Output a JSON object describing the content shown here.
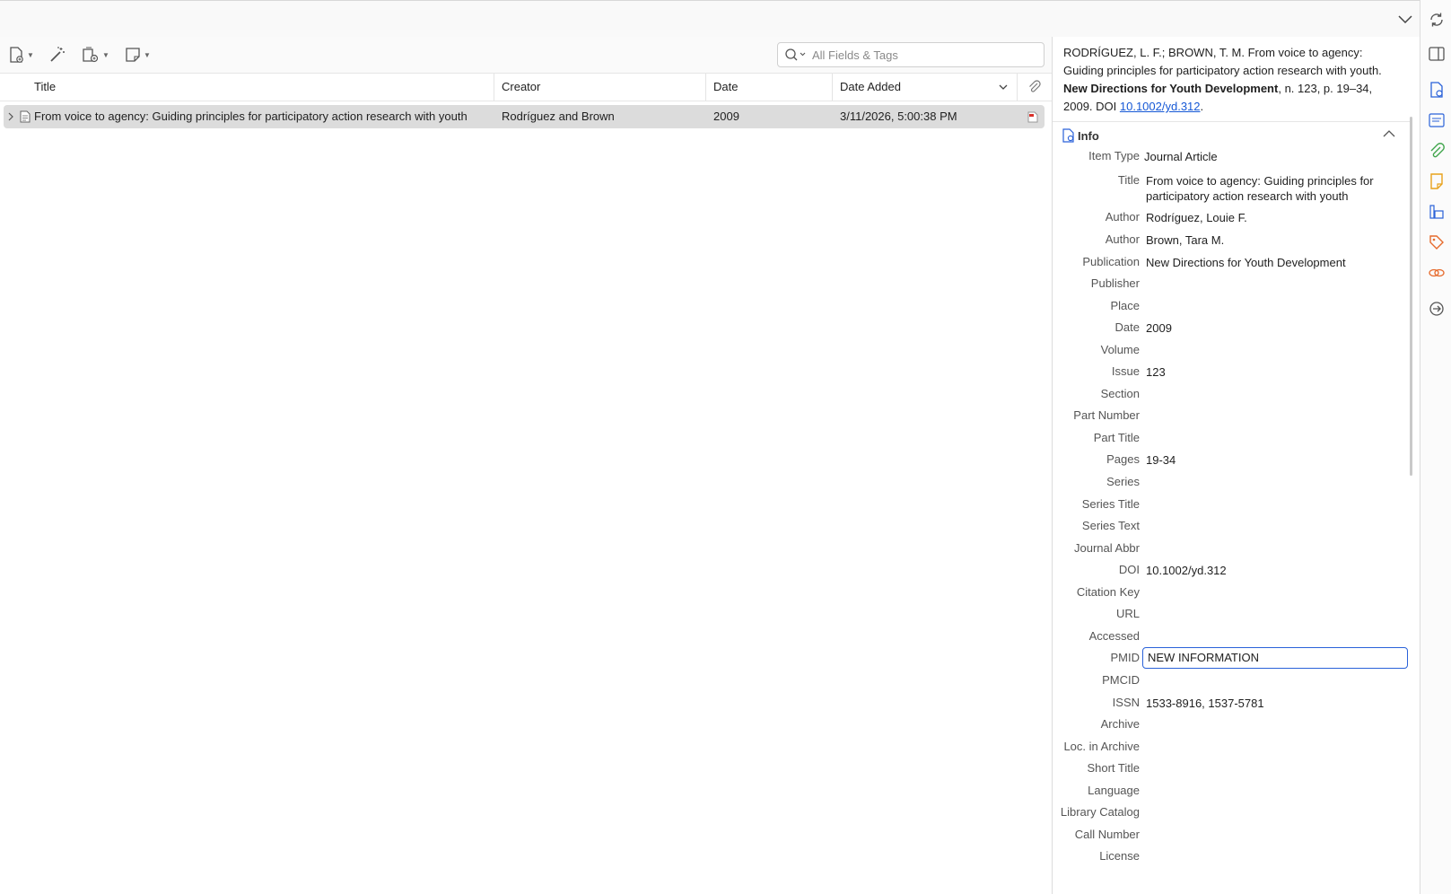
{
  "toolbar": {
    "search_placeholder": "All Fields & Tags"
  },
  "columns": {
    "title": "Title",
    "creator": "Creator",
    "date": "Date",
    "date_added": "Date Added"
  },
  "items": [
    {
      "title": "From voice to agency: Guiding principles for participatory action research with youth",
      "creator": "Rodríguez and Brown",
      "date": "2009",
      "date_added": "3/11/2026, 5:00:38 PM"
    }
  ],
  "citation": {
    "authors": "RODRÍGUEZ, L. F.; BROWN, T. M. From voice to agency: Guiding principles for participatory action research with youth. ",
    "journal": "New Directions for Youth Development",
    "rest": ", n. 123, p. 19–34, 2009. DOI ",
    "doi_link": "10.1002/yd.312",
    "end": "."
  },
  "info": {
    "header": "Info",
    "fields": [
      {
        "label": "Item Type",
        "value": "Journal Article"
      },
      {
        "label": "Title",
        "value": "From voice to agency: Guiding principles for participatory action research with youth"
      },
      {
        "label": "Author",
        "value": "Rodríguez, Louie F."
      },
      {
        "label": "Author",
        "value": "Brown, Tara M."
      },
      {
        "label": "Publication",
        "value": "New Directions for Youth Development"
      },
      {
        "label": "Publisher",
        "value": ""
      },
      {
        "label": "Place",
        "value": ""
      },
      {
        "label": "Date",
        "value": "2009"
      },
      {
        "label": "Volume",
        "value": ""
      },
      {
        "label": "Issue",
        "value": "123"
      },
      {
        "label": "Section",
        "value": ""
      },
      {
        "label": "Part Number",
        "value": ""
      },
      {
        "label": "Part Title",
        "value": ""
      },
      {
        "label": "Pages",
        "value": "19-34"
      },
      {
        "label": "Series",
        "value": ""
      },
      {
        "label": "Series Title",
        "value": ""
      },
      {
        "label": "Series Text",
        "value": ""
      },
      {
        "label": "Journal Abbr",
        "value": ""
      },
      {
        "label": "DOI",
        "value": "10.1002/yd.312"
      },
      {
        "label": "Citation Key",
        "value": ""
      },
      {
        "label": "URL",
        "value": ""
      },
      {
        "label": "Accessed",
        "value": ""
      },
      {
        "label": "PMID",
        "value": "NEW INFORMATION"
      },
      {
        "label": "PMCID",
        "value": ""
      },
      {
        "label": "ISSN",
        "value": "1533-8916, 1537-5781"
      },
      {
        "label": "Archive",
        "value": ""
      },
      {
        "label": "Loc. in Archive",
        "value": ""
      },
      {
        "label": "Short Title",
        "value": ""
      },
      {
        "label": "Language",
        "value": ""
      },
      {
        "label": "Library Catalog",
        "value": ""
      },
      {
        "label": "Call Number",
        "value": ""
      },
      {
        "label": "License",
        "value": ""
      }
    ]
  },
  "colors": {
    "accent": "#2a62d9",
    "link": "#1558d6",
    "selected_row": "#dcdcdc"
  }
}
